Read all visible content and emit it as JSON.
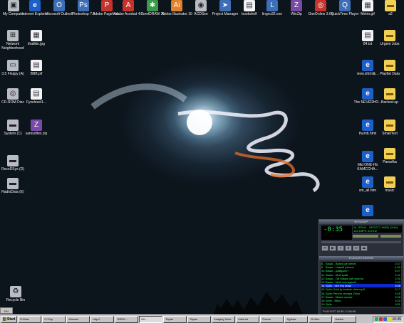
{
  "desktop": {
    "top_icons": [
      {
        "label": "My Computer",
        "icon": "computer-icon",
        "cls": "g-drive",
        "glyph": "▣"
      },
      {
        "label": "Internet Explorer",
        "icon": "internet-explorer-icon",
        "cls": "g-ie",
        "glyph": "e"
      },
      {
        "label": "Microsoft Outlook",
        "icon": "outlook-icon",
        "cls": "g-app",
        "glyph": "O"
      },
      {
        "label": "Photoshop 7.0",
        "icon": "photoshop-icon",
        "cls": "g-app",
        "glyph": "Ps"
      },
      {
        "label": "Adobe PageMak..",
        "icon": "pagemaker-icon",
        "cls": "g-red",
        "glyph": "P"
      },
      {
        "label": "Adobe Acrobat 4.0",
        "icon": "acrobat-icon",
        "cls": "g-red",
        "glyph": "A"
      },
      {
        "label": "CorelDRAW 11",
        "icon": "coreldraw-icon",
        "cls": "g-green",
        "glyph": "✱"
      },
      {
        "label": "Adobe Illustrator 10",
        "icon": "illustrator-icon",
        "cls": "g-orange",
        "glyph": "Ai"
      },
      {
        "label": "ACDSee",
        "icon": "acdsee-icon",
        "cls": "g-drive",
        "glyph": "◉"
      },
      {
        "label": "Project Manager",
        "icon": "project-manager-icon",
        "cls": "g-app",
        "glyph": "➤"
      },
      {
        "label": "bookshelf",
        "icon": "bookshelf-icon",
        "cls": "g-doc",
        "glyph": "▤"
      },
      {
        "label": "lingvo32.exe",
        "icon": "lingvo-icon",
        "cls": "g-app",
        "glyph": "L"
      },
      {
        "label": "WinZip",
        "icon": "winzip-icon",
        "cls": "g-purple",
        "glyph": "Z"
      },
      {
        "label": "OneOnline 3.06",
        "icon": "oneonline-icon",
        "cls": "g-red",
        "glyph": "◎"
      },
      {
        "label": "QuickTime Player",
        "icon": "quicktime-icon",
        "cls": "g-app",
        "glyph": "Q"
      },
      {
        "label": "Metro.gif",
        "icon": "image-file-icon",
        "cls": "g-doc",
        "glyph": "▦"
      },
      {
        "label": "a2",
        "icon": "folder-icon",
        "cls": "g-folder",
        "glyph": "▬"
      }
    ],
    "left_icons": [
      {
        "label": "Network Neighborhood",
        "icon": "network-icon",
        "cls": "g-drive",
        "glyph": "⊞"
      },
      {
        "label": "3.5 Floppy (A)",
        "icon": "floppy-icon",
        "cls": "g-drive",
        "glyph": "▭"
      },
      {
        "label": "CD-ROM Disc",
        "icon": "cdrom-icon",
        "cls": "g-drive",
        "glyph": "◎"
      },
      {
        "label": "System (C)",
        "icon": "hard-drive-icon",
        "cls": "g-drive",
        "glyph": "▬"
      },
      {
        "label": "RecoDSys (D)",
        "icon": "hard-drive-icon",
        "cls": "g-drive",
        "glyph": "▬"
      },
      {
        "label": "RadioData (E)",
        "icon": "hard-drive-icon",
        "cls": "g-drive",
        "glyph": "▬"
      }
    ],
    "left2_icons": [
      {
        "label": "thatikin.jpg",
        "icon": "image-file-icon",
        "cls": "g-doc",
        "glyph": "▦"
      },
      {
        "label": "BBB.pif",
        "icon": "pif-file-icon",
        "cls": "g-doc",
        "glyph": "▤"
      },
      {
        "label": "Fyxelexel1...",
        "icon": "document-icon",
        "cls": "g-doc",
        "glyph": "▤"
      },
      {
        "label": "samsoftex.zip",
        "icon": "zip-file-icon",
        "cls": "g-purple",
        "glyph": "Z"
      }
    ],
    "right_a_icons": [
      {
        "label": "84.txt",
        "icon": "text-file-icon",
        "cls": "g-doc",
        "glyph": "▤"
      },
      {
        "label": "view.shtml&...",
        "icon": "html-file-icon",
        "cls": "g-ie",
        "glyph": "e"
      },
      {
        "label": "The NEVERHO...",
        "icon": "html-file-icon",
        "cls": "g-ie",
        "glyph": "e"
      },
      {
        "label": "thumb.html",
        "icon": "html-file-icon",
        "cls": "g-ie",
        "glyph": "e"
      },
      {
        "label": "Mid ONE-Hb KAMCCHA...",
        "icon": "html-file-icon",
        "cls": "g-ie",
        "glyph": "e"
      },
      {
        "label": "sm_all.htm",
        "icon": "html-file-icon",
        "cls": "g-ie",
        "glyph": "e"
      },
      {
        "label": "",
        "icon": "html-file-icon",
        "cls": "g-ie",
        "glyph": "e"
      }
    ],
    "right_b_icons": [
      {
        "label": "Urgent Jobs",
        "icon": "folder-icon",
        "cls": "g-folder",
        "glyph": "▬"
      },
      {
        "label": "Playlist Data",
        "icon": "folder-icon",
        "cls": "g-folder",
        "glyph": "▬"
      },
      {
        "label": "Backed-up",
        "icon": "folder-icon",
        "cls": "g-folder",
        "glyph": "▬"
      },
      {
        "label": "SmallText",
        "icon": "folder-icon",
        "cls": "g-folder",
        "glyph": "▬"
      },
      {
        "label": "Parsolka",
        "icon": "folder-icon",
        "cls": "g-folder",
        "glyph": "▬"
      },
      {
        "label": "music",
        "icon": "folder-icon",
        "cls": "g-folder",
        "glyph": "▬"
      }
    ],
    "recycle": {
      "label": "Recycle Bin",
      "icon": "recycle-bin-icon"
    }
  },
  "winamp": {
    "title": "WINAMP",
    "time": "-0:35",
    "info": "14. SPLIN - ЧЕЛ ЕТУ НИЗА (3:46)",
    "bitrate": "128 KBPS 44 KHZ",
    "controls": [
      "⏮",
      "▶",
      "⏸",
      "⏹",
      "⏭",
      "⏏"
    ],
    "playlist_title": "PLAYLIST EDITOR",
    "playlist": [
      {
        "n": "8.",
        "t": "Ваши - Вьюга (je nieve)",
        "d": "2:47"
      },
      {
        "n": "9.",
        "t": "Ваши - Новый регион",
        "d": "4:50"
      },
      {
        "n": "10.",
        "t": "Ваши - Дайджест",
        "d": "5:27"
      },
      {
        "n": "11.",
        "t": "Ваши - Мой край",
        "d": "2:41"
      },
      {
        "n": "12.",
        "t": "Ваши - Ой Маша (ой просто)",
        "d": "2:30"
      },
      {
        "n": "13.",
        "t": "Ваши - Мой последний",
        "d": "2:59"
      },
      {
        "n": "14.",
        "t": "Splin - чел ету низа",
        "d": "3:46",
        "sel": true
      },
      {
        "n": "15.",
        "t": "Splin-Orbit ty budesh dela.mp3",
        "d": "3:17"
      },
      {
        "n": "16.",
        "t": "Splin-Pervoe vremya Zhivu",
        "d": "3:45"
      },
      {
        "n": "17.",
        "t": "Ваши - Мама проще",
        "d": "3:08"
      },
      {
        "n": "18.",
        "t": "Splin - Nikto",
        "d": "3:20"
      },
      {
        "n": "19.",
        "t": "Splin - ...",
        "d": "3:51"
      }
    ],
    "playlist_footer": "PLAYLIST 18:36 / 1:08:06"
  },
  "taskbar": {
    "start_label": "Start",
    "quick_launch": "EN",
    "buttons": [
      {
        "label": "E:\\Mac",
        "icon": "folder-icon"
      },
      {
        "label": "C:\\Tap",
        "icon": "folder-icon"
      },
      {
        "label": "Mowser",
        "icon": "app-icon"
      },
      {
        "label": "http://",
        "icon": "internet-explorer-icon"
      },
      {
        "label": "GRKK...",
        "icon": "app-icon"
      },
      {
        "label": "Mi...",
        "icon": "app-icon",
        "active": true
      },
      {
        "label": "Tapas",
        "icon": "app-icon"
      },
      {
        "label": "Tapas",
        "icon": "app-icon"
      },
      {
        "label": "Imaging View",
        "icon": "app-icon"
      },
      {
        "label": "Internet",
        "icon": "internet-explorer-icon"
      },
      {
        "label": "Poeao",
        "icon": "app-icon"
      },
      {
        "label": "JigSaw",
        "icon": "app-icon"
      },
      {
        "label": "D:\\Sec",
        "icon": "folder-icon"
      },
      {
        "label": "Adobe",
        "icon": "app-icon"
      }
    ],
    "clock": "16:45"
  }
}
